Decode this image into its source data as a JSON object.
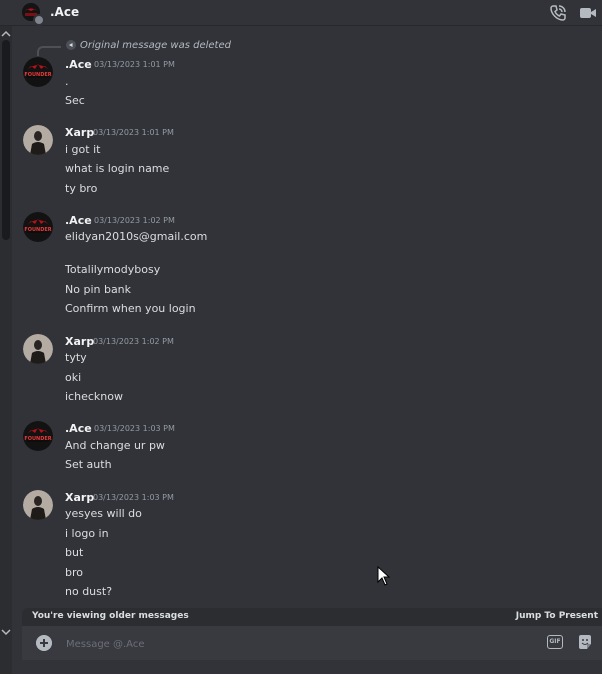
{
  "header": {
    "dm_name": ".Ace",
    "icons": [
      "phone-call-icon",
      "video-camera-icon"
    ]
  },
  "reply": {
    "text": "Original message was deleted"
  },
  "messages": [
    {
      "author": ".Ace",
      "timestamp": "03/13/2023 1:01 PM",
      "avatar": "founder-avatar",
      "lines": [
        ".",
        "Sec"
      ]
    },
    {
      "author": "Xarp",
      "timestamp": "03/13/2023 1:01 PM",
      "avatar": "xarp-avatar",
      "lines": [
        "i got it",
        "what is login name",
        "ty bro"
      ]
    },
    {
      "author": ".Ace",
      "timestamp": "03/13/2023 1:02 PM",
      "avatar": "founder-avatar",
      "lines": [
        "elidyan2010s@gmail.com",
        "",
        "Totalilymodybosy",
        "No pin bank",
        "Confirm when you login"
      ]
    },
    {
      "author": "Xarp",
      "timestamp": "03/13/2023 1:02 PM",
      "avatar": "xarp-avatar",
      "lines": [
        "tyty",
        "oki",
        "ichecknow"
      ]
    },
    {
      "author": ".Ace",
      "timestamp": "03/13/2023 1:03 PM",
      "avatar": "founder-avatar",
      "lines": [
        "And change ur pw",
        "Set auth"
      ]
    },
    {
      "author": "Xarp",
      "timestamp": "03/13/2023 1:03 PM",
      "avatar": "xarp-avatar",
      "lines": [
        "yesyes will do",
        "i logo in",
        "but",
        "bro",
        "no dust?"
      ]
    }
  ],
  "avatar_badge": "FOUNDER",
  "older_bar": {
    "notice": "You're viewing older messages",
    "jump_label": "Jump To Present"
  },
  "composer": {
    "placeholder": "Message @.Ace",
    "gif_label": "GIF"
  },
  "colors": {
    "background": "#313338",
    "composer": "#383a40",
    "bar": "#2b2d31",
    "text": "#dbdee1",
    "muted": "#949ba4"
  }
}
